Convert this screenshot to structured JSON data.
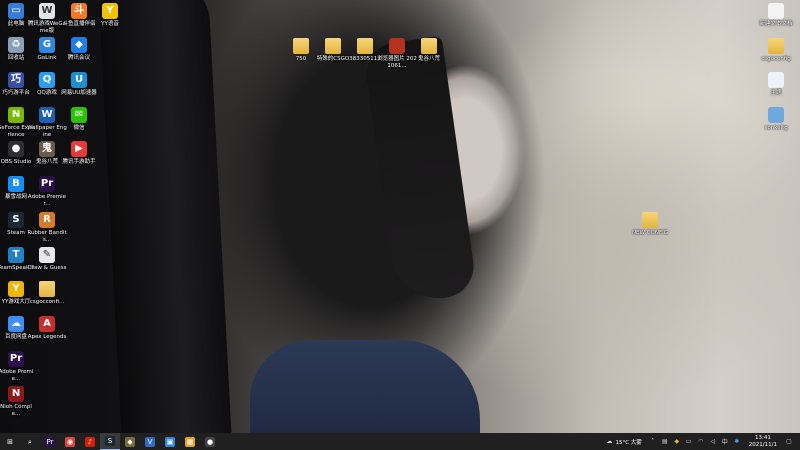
{
  "desktop": {
    "icons": [
      {
        "label": "此电脑",
        "glyph": "▭",
        "color": "#3a7bd5"
      },
      {
        "label": "腾讯游戏WeGame版",
        "glyph": "W",
        "color": "#dfe3ea"
      },
      {
        "label": "斗鱼直播伴侣",
        "glyph": "斗",
        "color": "#f07a2a"
      },
      {
        "label": "YY语音",
        "glyph": "Y",
        "color": "#f2c300"
      },
      {
        "label": "回收站",
        "glyph": "♻",
        "color": "#8aa0b8"
      },
      {
        "label": "GoLink",
        "glyph": "G",
        "color": "#2e86de"
      },
      {
        "label": "腾讯会议",
        "glyph": "◆",
        "color": "#1e7ce8"
      },
      {
        "label": "巧巧游平台",
        "glyph": "巧",
        "color": "#3b4fa8"
      },
      {
        "label": "QQ游戏",
        "glyph": "Q",
        "color": "#2a9df4"
      },
      {
        "label": "网易UU加速器",
        "glyph": "U",
        "color": "#1c8fd1"
      },
      {
        "label": "GeForce Experience",
        "glyph": "N",
        "color": "#76b900"
      },
      {
        "label": "Wallpaper Engine",
        "glyph": "W",
        "color": "#1f5fb3"
      },
      {
        "label": "微信",
        "glyph": "✉",
        "color": "#2dc100"
      },
      {
        "label": "OBS Studio",
        "glyph": "●",
        "color": "#302e31"
      },
      {
        "label": "鬼谷八荒",
        "glyph": "鬼",
        "color": "#6c5b4b"
      },
      {
        "label": "腾讯手游助手",
        "glyph": "▶",
        "color": "#e83a3a"
      },
      {
        "label": "暴雪战网",
        "glyph": "B",
        "color": "#148eff"
      },
      {
        "label": "Adobe Premier...",
        "glyph": "Pr",
        "color": "#2a0f4a"
      },
      {
        "label": "Steam",
        "glyph": "S",
        "color": "#1b2838"
      },
      {
        "label": "Rubber Bandits...",
        "glyph": "R",
        "color": "#d47a2a"
      },
      {
        "label": "TeamSpeak 3",
        "glyph": "T",
        "color": "#2580c3"
      },
      {
        "label": "Draw & Guess",
        "glyph": "✎",
        "color": "#e8e8e8"
      },
      {
        "label": "YY游戏大厅",
        "glyph": "Y",
        "color": "#f2b600"
      },
      {
        "label": "csgocconfi...",
        "glyph": "",
        "color": "#f6d57a"
      },
      {
        "label": "百度网盘",
        "glyph": "☁",
        "color": "#3f8df7"
      },
      {
        "label": "Apex Legends",
        "glyph": "A",
        "color": "#c43030"
      },
      {
        "label": "Adobe Premie...",
        "glyph": "Pr",
        "color": "#2a0f4a"
      },
      {
        "label": "Nioh Comple...",
        "glyph": "N",
        "color": "#8b1a1a"
      }
    ],
    "center_icons": [
      {
        "label": "750",
        "folder": true
      },
      {
        "label": "特殊的CSGO",
        "folder": true
      },
      {
        "label": "383305111",
        "folder": true
      },
      {
        "label": "浏览器图片 2021061...",
        "folder": false,
        "color": "#b3331f"
      },
      {
        "label": "鬼谷八荒",
        "folder": true
      }
    ],
    "right_icons": [
      {
        "label": "新建文本文档",
        "folder": false,
        "color": "#f4f4f4"
      },
      {
        "label": "csgoconfig",
        "folder": true
      },
      {
        "label": "主题",
        "folder": false,
        "color": "#eaf2fb"
      },
      {
        "label": "xonkeltg",
        "folder": false,
        "color": "#6fa8dc"
      }
    ],
    "new_config": {
      "label": "NEW CONFIG"
    }
  },
  "taskbar": {
    "apps": [
      {
        "name": "start",
        "glyph": "⊞",
        "color": "#202020"
      },
      {
        "name": "search",
        "glyph": "⌕",
        "color": "#202020"
      },
      {
        "name": "premiere",
        "glyph": "Pr",
        "color": "#2a0f4a"
      },
      {
        "name": "chrome",
        "glyph": "◉",
        "color": "#db4437"
      },
      {
        "name": "netease-music",
        "glyph": "♪",
        "color": "#d81e06"
      },
      {
        "name": "steam",
        "glyph": "S",
        "color": "#1b2838"
      },
      {
        "name": "csgo",
        "glyph": "◆",
        "color": "#7a6a3a"
      },
      {
        "name": "vpn",
        "glyph": "V",
        "color": "#2e6cc4"
      },
      {
        "name": "explorer-1",
        "glyph": "▣",
        "color": "#2f87d8"
      },
      {
        "name": "explorer-2",
        "glyph": "▦",
        "color": "#e8a020"
      },
      {
        "name": "obs",
        "glyph": "●",
        "color": "#444444"
      }
    ],
    "weather": "15°C 大雾",
    "time": "13:41",
    "date": "2021/11/1"
  }
}
